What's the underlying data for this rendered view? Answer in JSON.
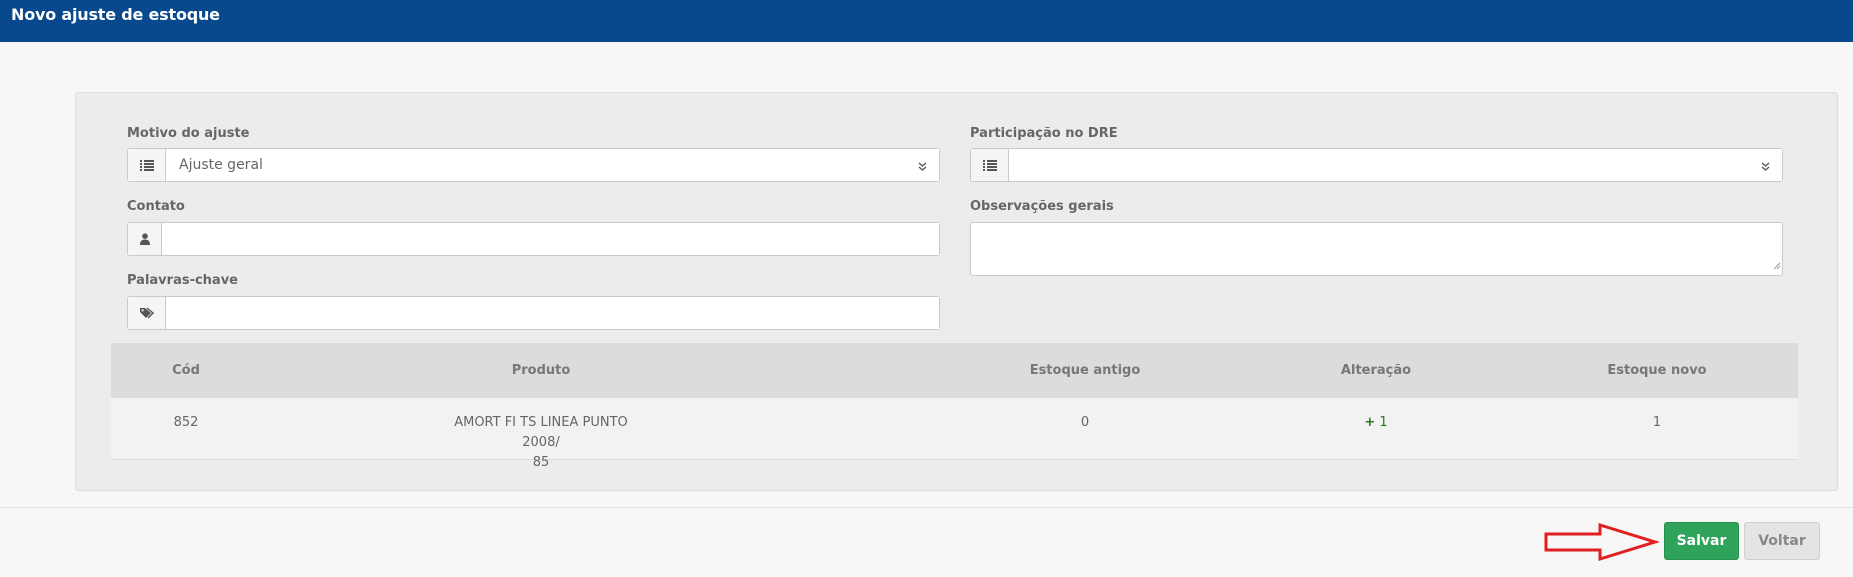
{
  "header": {
    "title": "Novo ajuste de estoque"
  },
  "form": {
    "motivo": {
      "label": "Motivo do ajuste",
      "value": "Ajuste geral",
      "icon": "list-icon"
    },
    "dre": {
      "label": "Participação no DRE",
      "value": "",
      "icon": "list-icon"
    },
    "contato": {
      "label": "Contato",
      "value": "",
      "icon": "user-icon"
    },
    "observacoes": {
      "label": "Observações gerais",
      "value": ""
    },
    "palavras": {
      "label": "Palavras-chave",
      "value": "",
      "icon": "tags-icon"
    }
  },
  "table": {
    "headers": {
      "cod": "Cód",
      "produto": "Produto",
      "estoque_antigo": "Estoque antigo",
      "alteracao": "Alteração",
      "estoque_novo": "Estoque novo"
    },
    "rows": [
      {
        "cod": "852",
        "produto_line1": "AMORT FI TS LINEA PUNTO 2008/",
        "produto_line2": "85",
        "estoque_antigo": "0",
        "alteracao_sign": "+",
        "alteracao": "1",
        "estoque_novo": "1"
      }
    ]
  },
  "actions": {
    "save_label": "Salvar",
    "back_label": "Voltar"
  },
  "colors": {
    "header": "#08488c",
    "save": "#2fa35a",
    "arrow": "#e02020",
    "plus": "#2a7a1f"
  }
}
